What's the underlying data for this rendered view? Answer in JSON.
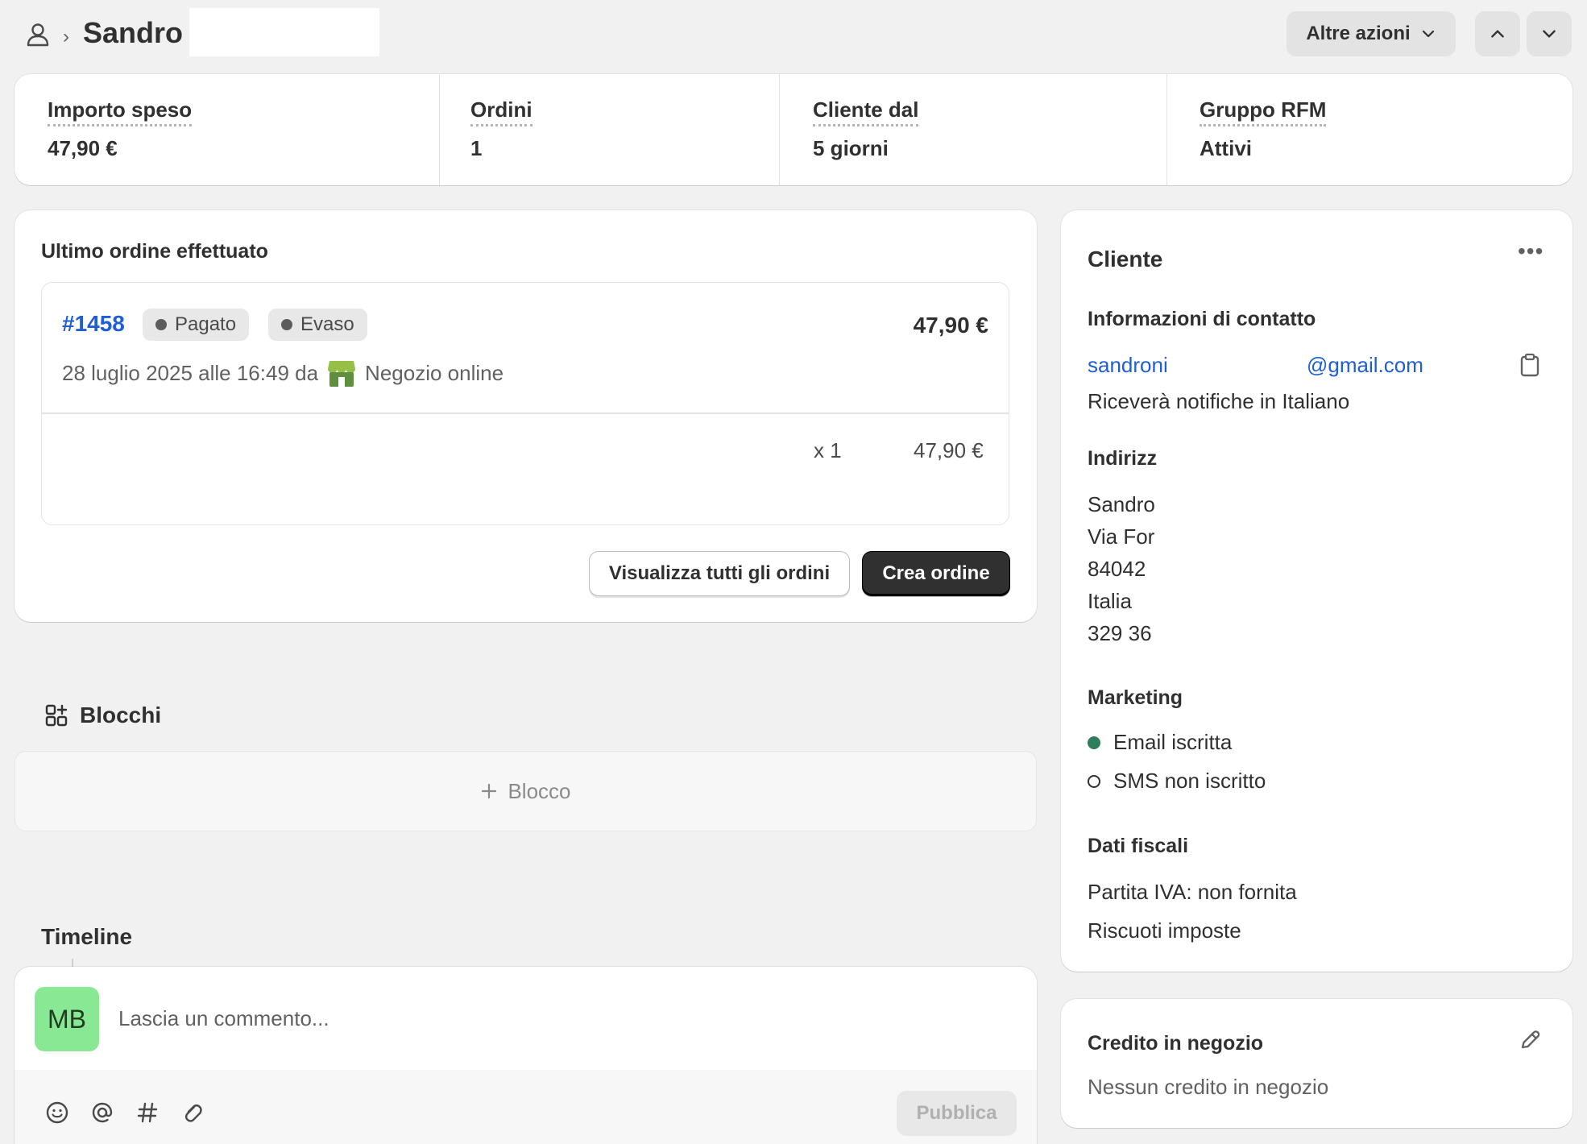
{
  "header": {
    "customer_name": "Sandro",
    "more_actions_label": "Altre azioni"
  },
  "metrics": [
    {
      "label": "Importo speso",
      "value": "47,90 €"
    },
    {
      "label": "Ordini",
      "value": "1"
    },
    {
      "label": "Cliente dal",
      "value": "5 giorni"
    },
    {
      "label": "Gruppo RFM",
      "value": "Attivi"
    }
  ],
  "last_order": {
    "section_title": "Ultimo ordine effettuato",
    "number": "#1458",
    "badges": [
      "Pagato",
      "Evaso"
    ],
    "total": "47,90 €",
    "date_text": "28 luglio 2025 alle 16:49 da",
    "channel": "Negozio online",
    "line_qty": "x 1",
    "line_price": "47,90 €",
    "view_all_label": "Visualizza tutti gli ordini",
    "create_label": "Crea ordine"
  },
  "blocks": {
    "title": "Blocchi",
    "add_label": "Blocco"
  },
  "timeline": {
    "title": "Timeline",
    "avatar_initials": "MB",
    "comment_placeholder": "Lascia un commento...",
    "publish_label": "Pubblica"
  },
  "customer": {
    "title": "Cliente",
    "contact_title": "Informazioni di contatto",
    "email_user": "sandroni",
    "email_domain": "@gmail.com",
    "notifications": "Riceverà notifiche in Italiano",
    "address_title": "Indirizz",
    "address_lines": [
      "Sandro",
      "Via For",
      "84042",
      "Italia",
      "329 36"
    ],
    "marketing_title": "Marketing",
    "email_status": "Email iscritta",
    "sms_status": "SMS non iscritto",
    "tax_title": "Dati fiscali",
    "vat": "Partita IVA: non fornita",
    "taxes": "Riscuoti imposte"
  },
  "store_credit": {
    "title": "Credito in negozio",
    "value": "Nessun credito in negozio"
  },
  "colors": {
    "link": "#1f5ed6",
    "avatar_bg": "#89e894",
    "email_subscribed": "#2e7d5b"
  }
}
